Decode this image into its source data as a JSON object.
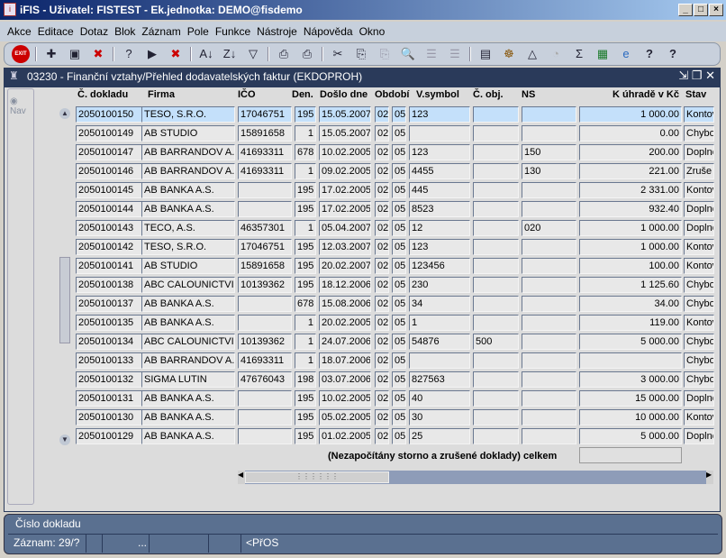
{
  "window": {
    "title": "iFIS - Uživatel: FISTEST - Ek.jednotka: DEMO@fisdemo",
    "min": "_",
    "max": "□",
    "close": "×"
  },
  "menu": [
    "Akce",
    "Editace",
    "Dotaz",
    "Blok",
    "Záznam",
    "Pole",
    "Funkce",
    "Nástroje",
    "Nápověda",
    "Okno"
  ],
  "toolbar": {
    "exit": "EXIT"
  },
  "form": {
    "title": "03230 - Finanční vztahy/Přehled dodavatelských faktur (EKDOPROH)",
    "nav": "Nav"
  },
  "columns": [
    "Č. dokladu",
    "Firma",
    "IČO",
    "Den.",
    "Došlo dne",
    "Období",
    "V.symbol",
    "Č. obj.",
    "NS",
    "K úhradě v Kč",
    "Stav"
  ],
  "rows": [
    [
      "2050100150",
      "TESO, S.R.O.",
      "17046751",
      "195",
      "15.05.2007",
      "02",
      "05",
      "123",
      "",
      "",
      "1 000.00",
      "Kontov"
    ],
    [
      "2050100149",
      "AB STUDIO",
      "15891658",
      "1",
      "15.05.2007",
      "02",
      "05",
      "",
      "",
      "",
      "0.00",
      "Chybo"
    ],
    [
      "2050100147",
      "AB BARRANDOV A.S.",
      "41693311",
      "678",
      "10.02.2005",
      "02",
      "05",
      "123",
      "",
      "150",
      "200.00",
      "Doplně"
    ],
    [
      "2050100146",
      "AB BARRANDOV A.S.",
      "41693311",
      "1",
      "09.02.2005",
      "02",
      "05",
      "4455",
      "",
      "130",
      "221.00",
      "Zruše"
    ],
    [
      "2050100145",
      "AB BANKA A.S.",
      "",
      "195",
      "17.02.2005",
      "02",
      "05",
      "445",
      "",
      "",
      "2 331.00",
      "Kontov"
    ],
    [
      "2050100144",
      "AB BANKA A.S.",
      "",
      "195",
      "17.02.2005",
      "02",
      "05",
      "8523",
      "",
      "",
      "932.40",
      "Doplně"
    ],
    [
      "2050100143",
      "TECO, A.S.",
      "46357301",
      "1",
      "05.04.2007",
      "02",
      "05",
      "12",
      "",
      "020",
      "1 000.00",
      "Doplně"
    ],
    [
      "2050100142",
      "TESO, S.R.O.",
      "17046751",
      "195",
      "12.03.2007",
      "02",
      "05",
      "123",
      "",
      "",
      "1 000.00",
      "Kontov"
    ],
    [
      "2050100141",
      "AB STUDIO",
      "15891658",
      "195",
      "20.02.2007",
      "02",
      "05",
      "123456",
      "",
      "",
      "100.00",
      "Kontov"
    ],
    [
      "2050100138",
      "ABC CALOUNICTVI p",
      "10139362",
      "195",
      "18.12.2006",
      "02",
      "05",
      "230",
      "",
      "",
      "1 125.60",
      "Chybo"
    ],
    [
      "2050100137",
      "AB BANKA A.S.",
      "",
      "678",
      "15.08.2006",
      "02",
      "05",
      "34",
      "",
      "",
      "34.00",
      "Chybo"
    ],
    [
      "2050100135",
      "AB BANKA A.S.",
      "",
      "1",
      "20.02.2005",
      "02",
      "05",
      "1",
      "",
      "",
      "119.00",
      "Kontov"
    ],
    [
      "2050100134",
      "ABC CALOUNICTVI s",
      "10139362",
      "1",
      "24.07.2006",
      "02",
      "05",
      "54876",
      "500",
      "",
      "5 000.00",
      "Chybo"
    ],
    [
      "2050100133",
      "AB BARRANDOV A.S.",
      "41693311",
      "1",
      "18.07.2006",
      "02",
      "05",
      "",
      "",
      "",
      "",
      "Chybo"
    ],
    [
      "2050100132",
      "SIGMA LUTIN",
      "47676043",
      "198",
      "03.07.2006",
      "02",
      "05",
      "827563",
      "",
      "",
      "3 000.00",
      "Chybo"
    ],
    [
      "2050100131",
      "AB BANKA A.S.",
      "",
      "195",
      "10.02.2005",
      "02",
      "05",
      "40",
      "",
      "",
      "15 000.00",
      "Doplně"
    ],
    [
      "2050100130",
      "AB BANKA A.S.",
      "",
      "195",
      "05.02.2005",
      "02",
      "05",
      "30",
      "",
      "",
      "10 000.00",
      "Kontov"
    ],
    [
      "2050100129",
      "AB BANKA A.S.",
      "",
      "195",
      "01.02.2005",
      "02",
      "05",
      "25",
      "",
      "",
      "5 000.00",
      "Doplně"
    ]
  ],
  "total": {
    "label": "(Nezapočítány storno a zrušené doklady) celkem",
    "value": ""
  },
  "status": {
    "field": "Číslo dokladu",
    "record": "Záznam: 29/?",
    "dots": "...",
    "mode": "<PřOS"
  }
}
